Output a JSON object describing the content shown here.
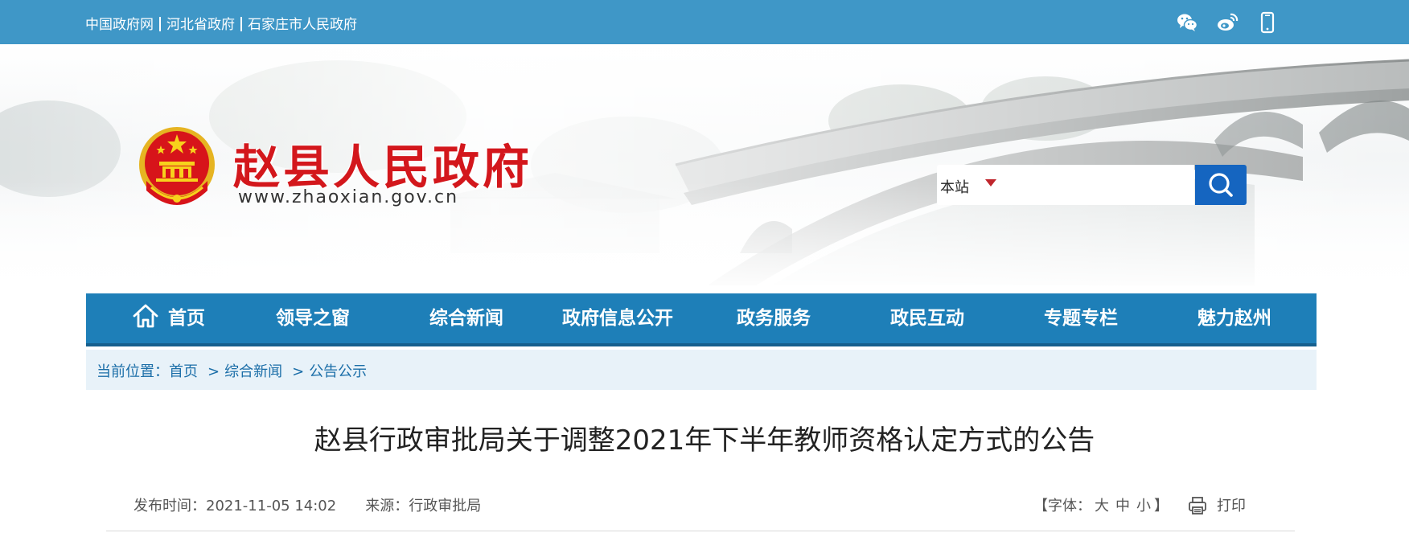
{
  "topbar": {
    "links": [
      "中国政府网",
      "河北省政府",
      "石家庄市人民政府"
    ],
    "icons": [
      "wechat-icon",
      "weibo-icon",
      "mobile-icon"
    ]
  },
  "header": {
    "site_title": "赵县人民政府",
    "site_url": "www.zhaoxian.gov.cn"
  },
  "search": {
    "scope": "本站",
    "value": ""
  },
  "nav": {
    "items": [
      "首页",
      "领导之窗",
      "综合新闻",
      "政府信息公开",
      "政务服务",
      "政民互动",
      "专题专栏",
      "魅力赵州"
    ]
  },
  "breadcrumb": {
    "label": "当前位置：",
    "items": [
      "首页",
      "综合新闻",
      "公告公示"
    ],
    "separator": ">"
  },
  "article": {
    "title": "赵县行政审批局关于调整2021年下半年教师资格认定方式的公告",
    "publish_label": "发布时间：",
    "publish_time": "2021-11-05 14:02",
    "source_label": "来源：",
    "source": "行政审批局",
    "font_label_open": "【字体：",
    "font_sizes": [
      "大",
      "中",
      "小"
    ],
    "font_label_close": "】",
    "print_label": "打印"
  },
  "colors": {
    "topbar": "#3f97c7",
    "nav": "#1e7fb8",
    "title_red": "#d3171c",
    "search_button": "#1565c0",
    "breadcrumb_bg": "#e8f2f9"
  }
}
